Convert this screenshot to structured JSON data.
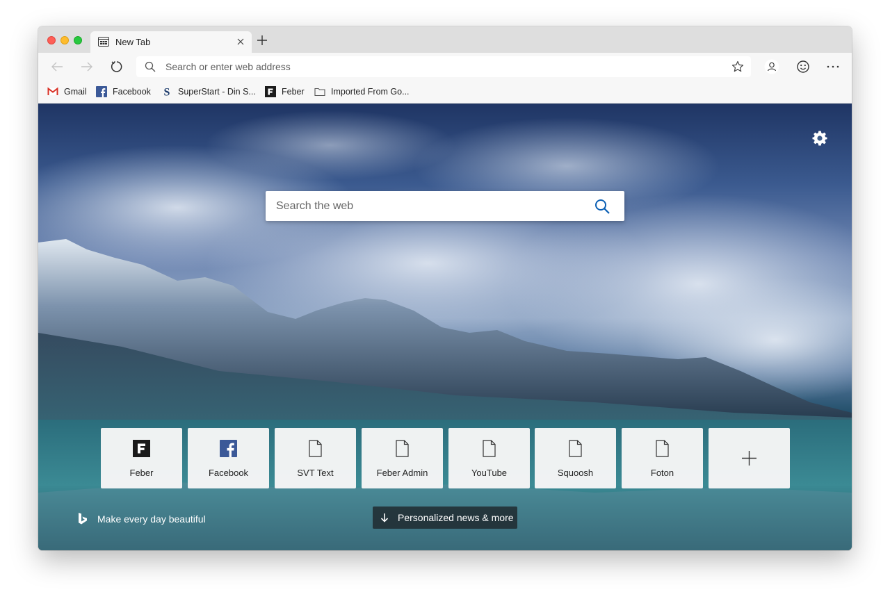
{
  "window": {
    "tab_title": "New Tab",
    "traffic_lights": [
      "#fe5f57",
      "#febc2e",
      "#28c840"
    ]
  },
  "toolbar": {
    "address_placeholder": "Search or enter web address",
    "icons": [
      "back-arrow-icon",
      "forward-arrow-icon",
      "refresh-icon",
      "search-icon",
      "star-icon",
      "profile-icon",
      "emoji-feedback-icon",
      "more-icon"
    ]
  },
  "bookmarks": [
    {
      "label": "Gmail",
      "icon": "gmail-icon"
    },
    {
      "label": "Facebook",
      "icon": "facebook-icon"
    },
    {
      "label": "SuperStart - Din S...",
      "icon": "superstart-icon"
    },
    {
      "label": "Feber",
      "icon": "feber-icon"
    },
    {
      "label": "Imported From Go...",
      "icon": "folder-icon"
    }
  ],
  "newtab": {
    "search_placeholder": "Search the web",
    "tiles": [
      {
        "label": "Feber",
        "icon": "feber-icon"
      },
      {
        "label": "Facebook",
        "icon": "facebook-icon"
      },
      {
        "label": "SVT Text",
        "icon": "page-icon"
      },
      {
        "label": "Feber Admin",
        "icon": "page-icon"
      },
      {
        "label": "YouTube",
        "icon": "page-icon"
      },
      {
        "label": "Squoosh",
        "icon": "page-icon"
      },
      {
        "label": "Foton",
        "icon": "page-icon"
      },
      {
        "label": "",
        "icon": "plus-icon"
      }
    ],
    "bing_text": "Make every day beautiful",
    "news_button": "Personalized news & more"
  },
  "colors": {
    "facebook_blue": "#3b5998",
    "gmail_red": "#d93025",
    "accent_blue": "#0a5fb4"
  }
}
